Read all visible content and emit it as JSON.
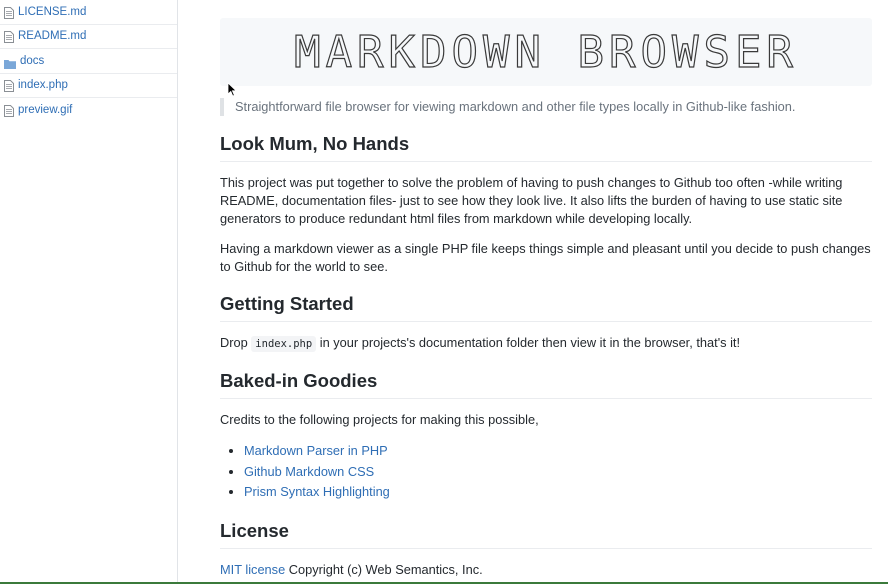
{
  "sidebar": {
    "files": [
      {
        "name": "LICENSE.md",
        "icon": "file-icon"
      },
      {
        "name": "README.md",
        "icon": "file-icon"
      },
      {
        "name": "docs",
        "icon": "folder-icon"
      },
      {
        "name": "index.php",
        "icon": "file-icon"
      },
      {
        "name": "preview.gif",
        "icon": "file-icon"
      }
    ]
  },
  "main": {
    "banner": {
      "text": "MARKDOWN BROWSER"
    },
    "tagline": "Straightforward file browser for viewing markdown and other file types locally in Github-like fashion.",
    "section1": {
      "heading": "Look Mum, No Hands",
      "para1": "This project was put together to solve the problem of having to push changes to Github too often -while writing README, documentation files- just to see how they look live. It also lifts the burden of having to use static site generators to produce redundant html files from markdown while developing locally.",
      "para2": "Having a markdown viewer as a single PHP file keeps things simple and pleasant until you decide to push changes to Github for the world to see."
    },
    "section2": {
      "heading": "Getting Started",
      "text_before": "Drop ",
      "code": "index.php",
      "text_after": " in your projects's documentation folder then view it in the browser, that's it!"
    },
    "section3": {
      "heading": "Baked-in Goodies",
      "intro": "Credits to the following projects for making this possible,",
      "links": [
        "Markdown Parser in PHP",
        "Github Markdown CSS",
        "Prism Syntax Highlighting"
      ]
    },
    "section4": {
      "heading": "License",
      "link": "MIT license",
      "text": " Copyright (c) Web Semantics, Inc."
    }
  },
  "colors": {
    "link": "#2f6eb5",
    "text": "#24292e",
    "muted": "#6a737d",
    "banner_bg": "#f6f8fa"
  }
}
